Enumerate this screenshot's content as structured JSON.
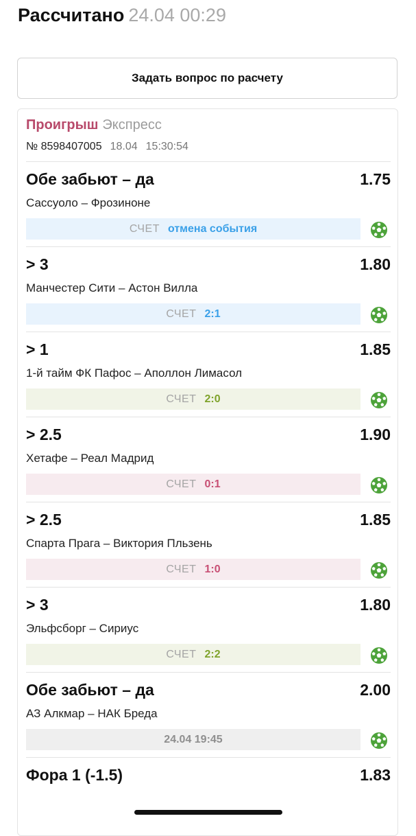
{
  "header": {
    "title": "Рассчитано",
    "datetime": "24.04 00:29"
  },
  "ask_button": {
    "label": "Задать вопрос по расчету"
  },
  "bet": {
    "result": "Проигрыш",
    "type": "Экспресс",
    "number": "№ 8598407005",
    "date": "18.04",
    "time": "15:30:54"
  },
  "events": [
    {
      "market": "Обе забьют – да",
      "odds": "1.75",
      "teams": "Сассуоло – Фрозиноне",
      "score_label": "СЧЕТ",
      "score": "отмена события",
      "status": "blue",
      "icon": "football-icon"
    },
    {
      "market": "> 3",
      "odds": "1.80",
      "teams": "Манчестер Сити – Астон Вилла",
      "score_label": "СЧЕТ",
      "score": "2:1",
      "status": "blue",
      "icon": "football-icon"
    },
    {
      "market": "> 1",
      "odds": "1.85",
      "teams": "1-й тайм ФК Пафос – Аполлон Лимасол",
      "score_label": "СЧЕТ",
      "score": "2:0",
      "status": "green",
      "icon": "football-icon"
    },
    {
      "market": "> 2.5",
      "odds": "1.90",
      "teams": "Хетафе – Реал Мадрид",
      "score_label": "СЧЕТ",
      "score": "0:1",
      "status": "red",
      "icon": "football-icon"
    },
    {
      "market": "> 2.5",
      "odds": "1.85",
      "teams": "Спарта Прага – Виктория Пльзень",
      "score_label": "СЧЕТ",
      "score": "1:0",
      "status": "red",
      "icon": "football-icon"
    },
    {
      "market": "> 3",
      "odds": "1.80",
      "teams": "Эльфсборг – Сириус",
      "score_label": "СЧЕТ",
      "score": "2:2",
      "status": "green",
      "icon": "football-icon"
    },
    {
      "market": "Обе забьют – да",
      "odds": "2.00",
      "teams": "АЗ Алкмар – НАК Бреда",
      "score_label": "",
      "score": "24.04 19:45",
      "status": "gray",
      "icon": "football-icon"
    },
    {
      "market": "Фора 1 (-1.5)",
      "odds": "1.83",
      "teams": "",
      "score_label": "",
      "score": "",
      "status": "",
      "icon": ""
    }
  ],
  "colors": {
    "loss": "#b84a6b",
    "blue": "#3aa0e8",
    "green": "#7fa32b",
    "red": "#c84f74",
    "ball": "#4da33a"
  }
}
